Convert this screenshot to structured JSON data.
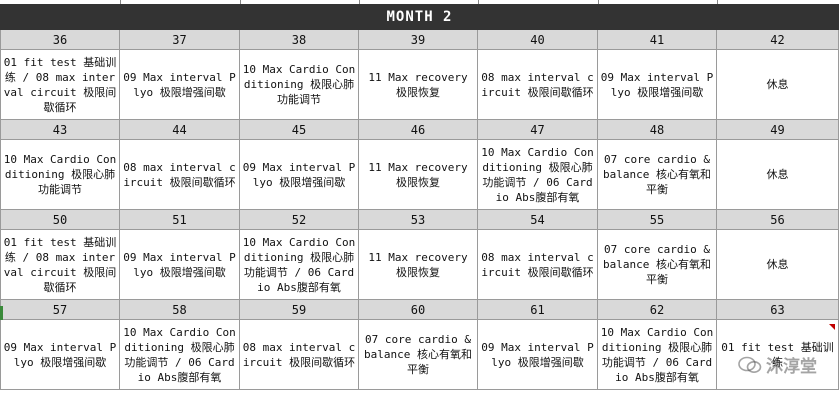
{
  "title": "MONTH 2",
  "weeks": [
    {
      "days": [
        "36",
        "37",
        "38",
        "39",
        "40",
        "41",
        "42"
      ],
      "activities": [
        "01 fit test 基础训练 / 08 max interval circuit 极限间歇循环",
        "09  Max interval Plyo 极限增强间歇",
        "10 Max Cardio Conditioning 极限心肺功能调节",
        "11 Max recovery 极限恢复",
        "08 max interval circuit 极限间歇循环",
        "09  Max interval Plyo 极限增强间歇",
        "休息"
      ]
    },
    {
      "days": [
        "43",
        "44",
        "45",
        "46",
        "47",
        "48",
        "49"
      ],
      "activities": [
        "10 Max Cardio Conditioning 极限心肺功能调节",
        "08 max interval circuit 极限间歇循环",
        "09  Max interval Plyo 极限增强间歇",
        "11 Max recovery 极限恢复",
        "10 Max Cardio Conditioning 极限心肺功能调节  / 06  Cardio Abs腹部有氧",
        "07 core cardio & balance 核心有氧和平衡",
        "休息"
      ]
    },
    {
      "days": [
        "50",
        "51",
        "52",
        "53",
        "54",
        "55",
        "56"
      ],
      "activities": [
        "01 fit test 基础训练 / 08 max interval circuit 极限间歇循环",
        "09  Max interval Plyo 极限增强间歇",
        "10 Max Cardio Conditioning 极限心肺功能调节  / 06  Cardio Abs腹部有氧",
        "11 Max recovery 极限恢复",
        "08 max interval circuit 极限间歇循环",
        "07 core cardio & balance 核心有氧和平衡",
        "休息"
      ]
    },
    {
      "days": [
        "57",
        "58",
        "59",
        "60",
        "61",
        "62",
        "63"
      ],
      "activities": [
        "09  Max interval Plyo 极限增强间歇",
        "10 Max Cardio Conditioning 极限心肺功能调节  / 06  Cardio Abs腹部有氧",
        "08 max interval circuit 极限间歇循环",
        "07 core cardio & balance 核心有氧和平衡",
        "09  Max interval Plyo 极限增强间歇",
        "10 Max Cardio Conditioning 极限心肺功能调节  / 06  Cardio Abs腹部有氧",
        "01 fit test 基础训练"
      ]
    }
  ],
  "watermark": "沐淳堂"
}
